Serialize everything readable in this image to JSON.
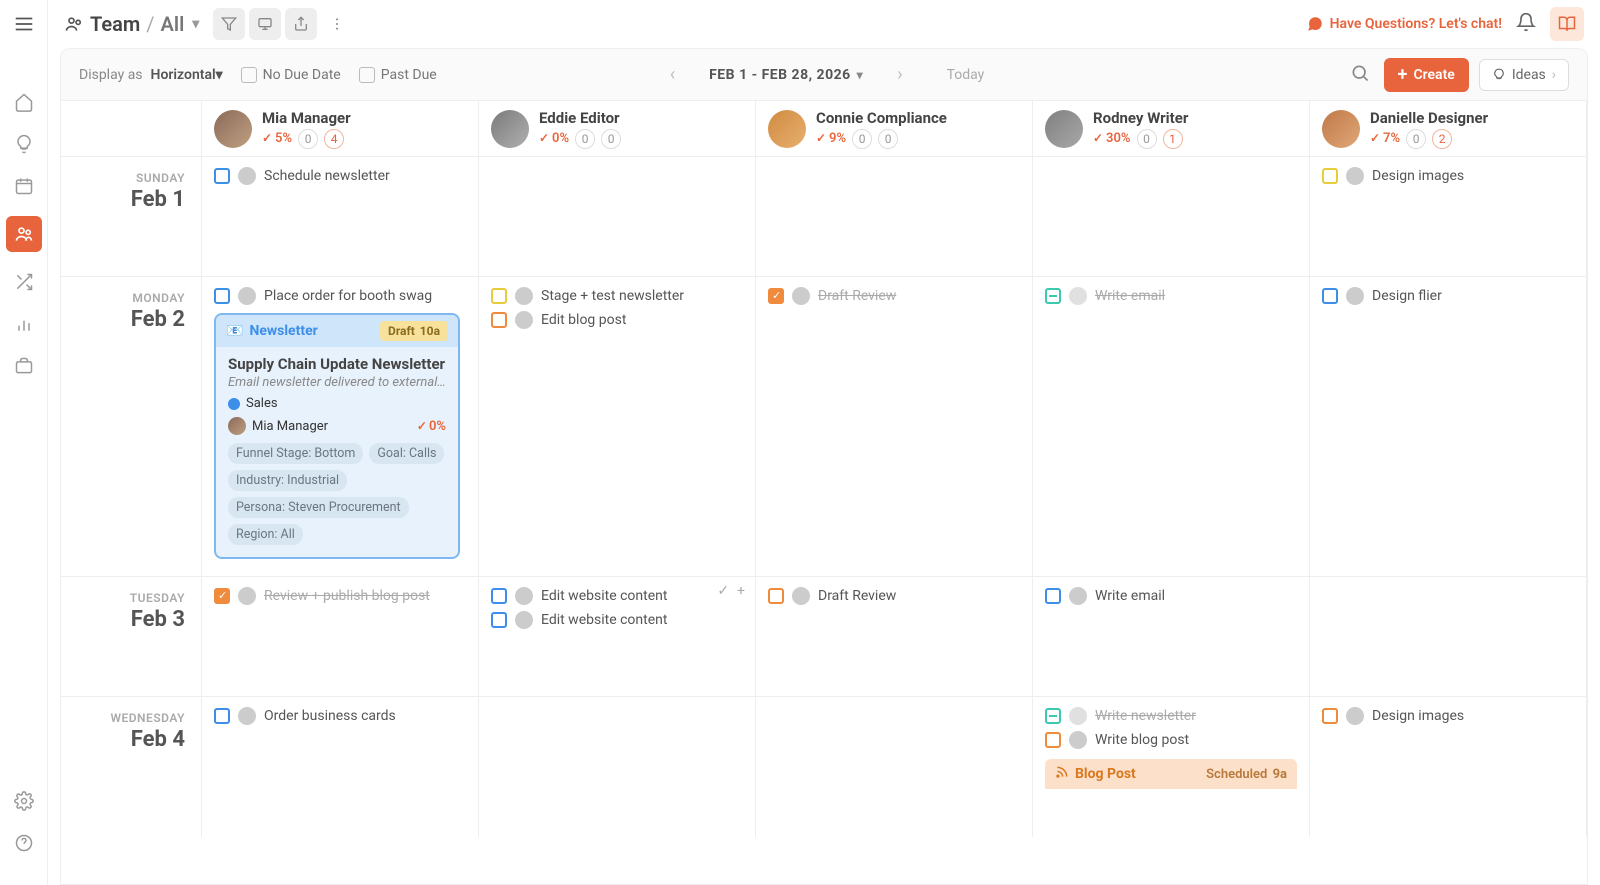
{
  "breadcrumb": {
    "team": "Team",
    "sep": "/",
    "all": "All"
  },
  "topbar": {
    "chat": "Have Questions? Let's chat!"
  },
  "viewheader": {
    "displayAs": "Display as",
    "mode": "Horizontal",
    "noDueDate": "No Due Date",
    "pastDue": "Past Due",
    "range": "FEB 1 - FEB 28, 2026",
    "today": "Today",
    "create": "Create",
    "ideas": "Ideas"
  },
  "people": [
    {
      "name": "Mia Manager",
      "pct": "5%",
      "c1": "0",
      "c2": "4",
      "warn": true
    },
    {
      "name": "Eddie Editor",
      "pct": "0%",
      "c1": "0",
      "c2": "0",
      "warn": false
    },
    {
      "name": "Connie Compliance",
      "pct": "9%",
      "c1": "0",
      "c2": "0",
      "warn": false
    },
    {
      "name": "Rodney Writer",
      "pct": "30%",
      "c1": "0",
      "c2": "1",
      "warn": true
    },
    {
      "name": "Danielle Designer",
      "pct": "7%",
      "c1": "0",
      "c2": "2",
      "warn": true
    }
  ],
  "days": [
    {
      "dow": "SUNDAY",
      "date": "Feb 1"
    },
    {
      "dow": "MONDAY",
      "date": "Feb 2"
    },
    {
      "dow": "TUESDAY",
      "date": "Feb 3"
    },
    {
      "dow": "WEDNESDAY",
      "date": "Feb 4"
    }
  ],
  "tasks": {
    "d0": {
      "p0": "Schedule newsletter",
      "p4": "Design images"
    },
    "d1": {
      "p0": "Place order for booth swag",
      "p1a": "Stage + test newsletter",
      "p1b": "Edit blog post",
      "p2": "Draft Review",
      "p3": "Write email",
      "p4": "Design flier"
    },
    "d2": {
      "p0": "Review + publish blog post",
      "p1a": "Edit website content",
      "p1b": "Edit website content",
      "p2": "Draft Review",
      "p3": "Write email"
    },
    "d3": {
      "p0": "Order business cards",
      "p3a": "Write newsletter",
      "p3b": "Write blog post",
      "p4": "Design images"
    }
  },
  "card": {
    "type": "Newsletter",
    "badge": "Draft",
    "time": "10a",
    "title": "Supply Chain Update Newsletter",
    "desc": "Email newsletter delivered to external i…",
    "label": "Sales",
    "owner": "Mia Manager",
    "pct": "0%",
    "tags": [
      "Funnel Stage: Bottom",
      "Goal: Calls",
      "Industry: Industrial",
      "Persona: Steven Procurement",
      "Region: All"
    ]
  },
  "projbar": {
    "type": "Blog Post",
    "status": "Scheduled",
    "time": "9a"
  }
}
